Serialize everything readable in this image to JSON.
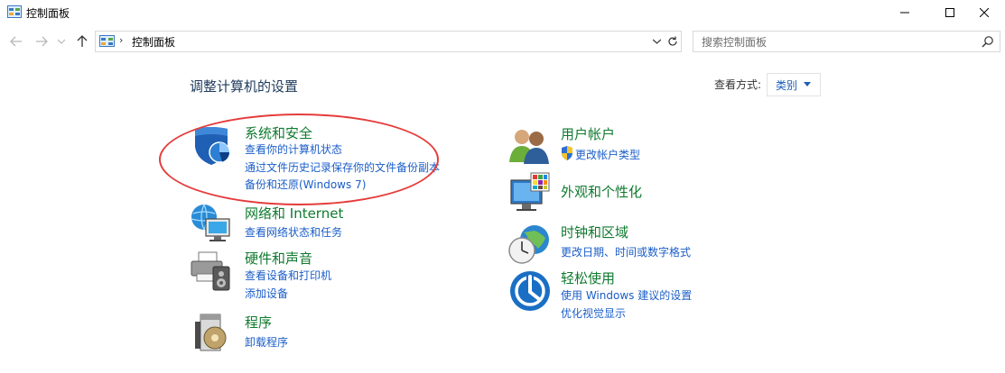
{
  "window": {
    "title": "控制面板",
    "minimize_glyph": "—",
    "maximize_glyph": "☐",
    "close_glyph": "✕"
  },
  "nav": {
    "back_glyph": "←",
    "forward_glyph": "→",
    "recent_glyph": "⌄",
    "up_glyph": "↑"
  },
  "address": {
    "separator": "›",
    "path": "控制面板",
    "dropdown_glyph": "⌄",
    "refresh_glyph": "↻"
  },
  "search": {
    "placeholder": "搜索控制面板"
  },
  "main": {
    "heading": "调整计算机的设置",
    "view_by_label": "查看方式:",
    "view_by_value": "类别"
  },
  "categories": {
    "system_security": {
      "title": "系统和安全",
      "links": [
        "查看你的计算机状态",
        "通过文件历史记录保存你的文件备份副本",
        "备份和还原(Windows 7)"
      ]
    },
    "network": {
      "title": "网络和 Internet",
      "links": [
        "查看网络状态和任务"
      ]
    },
    "hardware_sound": {
      "title": "硬件和声音",
      "links": [
        "查看设备和打印机",
        "添加设备"
      ]
    },
    "programs": {
      "title": "程序",
      "links": [
        "卸载程序"
      ]
    },
    "user_accounts": {
      "title": "用户帐户",
      "links": [
        "更改帐户类型"
      ]
    },
    "appearance": {
      "title": "外观和个性化",
      "links": []
    },
    "clock_region": {
      "title": "时钟和区域",
      "links": [
        "更改日期、时间或数字格式"
      ]
    },
    "ease_of_access": {
      "title": "轻松使用",
      "links": [
        "使用 Windows 建议的设置",
        "优化视觉显示"
      ]
    }
  },
  "colors": {
    "category_title": "#0f7a2f",
    "link": "#1b5ec8",
    "heading": "#1e395b",
    "annotation": "#e53c3c"
  }
}
